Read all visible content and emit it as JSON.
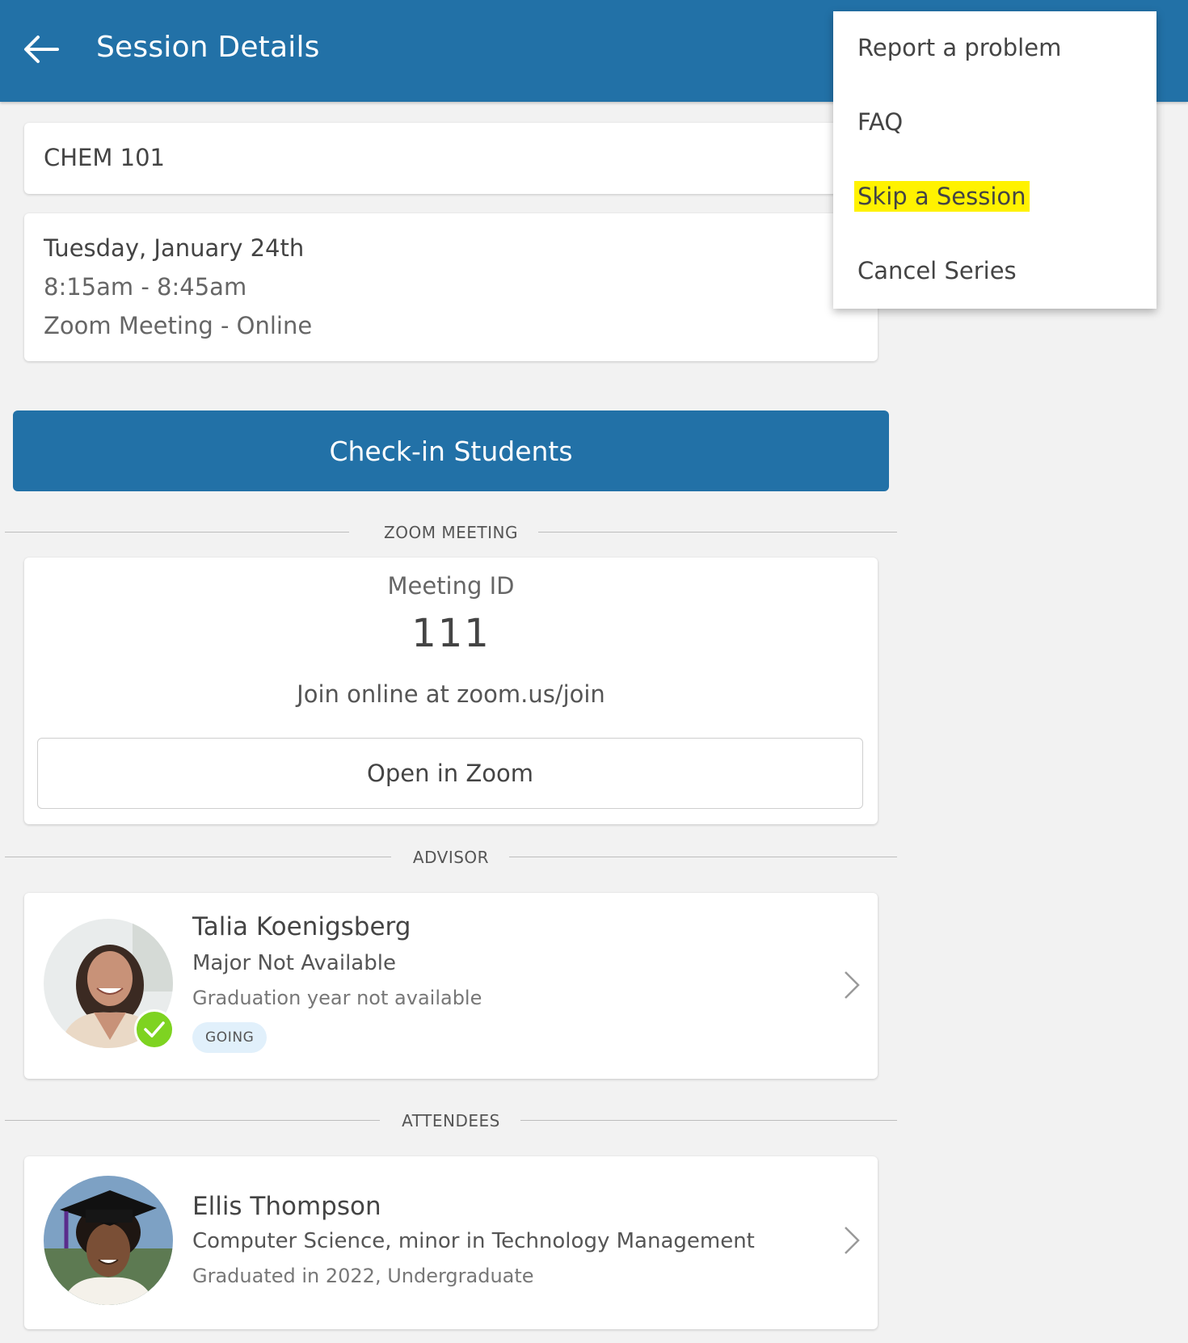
{
  "header": {
    "title": "Session Details",
    "back_icon": "arrow-left-icon",
    "color": "#2271a7"
  },
  "session": {
    "course": "CHEM 101",
    "date": "Tuesday, January 24th",
    "time": "8:15am - 8:45am",
    "location": "Zoom Meeting - Online"
  },
  "checkin_button": {
    "label": "Check-in Students"
  },
  "zoom": {
    "section_label": "ZOOM MEETING",
    "meeting_id_label": "Meeting ID",
    "meeting_id": "111",
    "join_text": "Join online at zoom.us/join",
    "open_button": "Open in Zoom"
  },
  "advisor": {
    "section_label": "ADVISOR",
    "name": "Talia Koenigsberg",
    "major": "Major Not Available",
    "grad": "Graduation year not available",
    "status": "GOING",
    "status_color": "#e1f0fb",
    "check_color": "#7ed321"
  },
  "attendees": {
    "section_label": "ATTENDEES",
    "items": [
      {
        "name": "Ellis Thompson",
        "major": "Computer Science, minor in Technology Management",
        "grad": "Graduated in 2022, Undergraduate"
      }
    ]
  },
  "menu": {
    "items": [
      {
        "label": "Report a problem"
      },
      {
        "label": "FAQ"
      },
      {
        "label": "Skip a Session",
        "highlighted": true
      },
      {
        "label": "Cancel Series"
      }
    ],
    "highlight_color": "#fff200"
  }
}
